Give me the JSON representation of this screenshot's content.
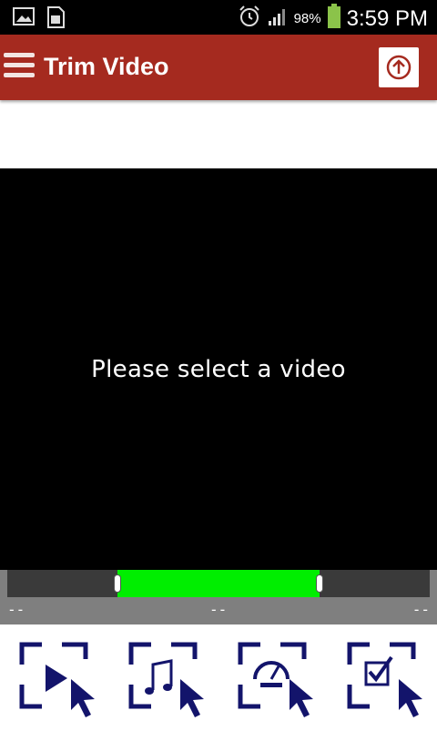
{
  "status_bar": {
    "battery_percent": "98%",
    "time": "3:59 PM"
  },
  "app_bar": {
    "title": "Trim Video"
  },
  "video": {
    "placeholder": "Please select a video"
  },
  "trim": {
    "start_label": "--",
    "middle_label": "--",
    "end_label": "--",
    "selection_start_fraction": 0.26,
    "selection_end_fraction": 0.74,
    "selection_color": "#00ee00"
  },
  "toolbar": {
    "tools": [
      {
        "icon": "select-video-icon"
      },
      {
        "icon": "select-audio-icon"
      },
      {
        "icon": "speed-icon"
      },
      {
        "icon": "confirm-selection-icon"
      }
    ]
  },
  "colors": {
    "app_bar": "#a52a1f",
    "icon_accent": "#13146b"
  }
}
